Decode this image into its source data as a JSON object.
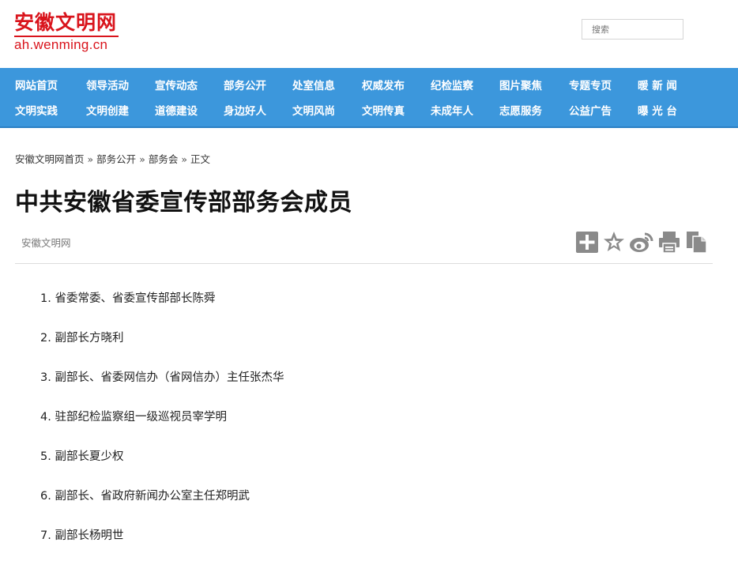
{
  "site": {
    "logo_cn": "安徽文明网",
    "logo_en": "ah.wenming.cn",
    "brand_color": "#d9141c"
  },
  "search": {
    "placeholder": "搜索"
  },
  "nav": {
    "background": "#3c97dc",
    "row1": [
      "网站首页",
      "领导活动",
      "宣传动态",
      "部务公开",
      "处室信息",
      "权威发布",
      "纪检监察",
      "图片聚焦",
      "专题专页",
      "暖 新 闻"
    ],
    "row2": [
      "文明实践",
      "文明创建",
      "道德建设",
      "身边好人",
      "文明风尚",
      "文明传真",
      "未成年人",
      "志愿服务",
      "公益广告",
      "曝 光 台"
    ]
  },
  "breadcrumb": [
    "安徽文明网首页",
    "部务公开",
    "部务会",
    "正文"
  ],
  "breadcrumb_sep": "»",
  "article": {
    "title": "中共安徽省委宣传部部务会成员",
    "source": "安徽文明网",
    "share_icons": [
      "add-icon",
      "star-icon",
      "weibo-icon",
      "print-icon",
      "copy-icon"
    ],
    "members": [
      "1. 省委常委、省委宣传部部长陈舜",
      "2. 副部长方晓利",
      "3. 副部长、省委网信办（省网信办）主任张杰华",
      "4. 驻部纪检监察组一级巡视员宰学明",
      "5. 副部长夏少权",
      "6. 副部长、省政府新闻办公室主任郑明武",
      "7. 副部长杨明世"
    ]
  }
}
